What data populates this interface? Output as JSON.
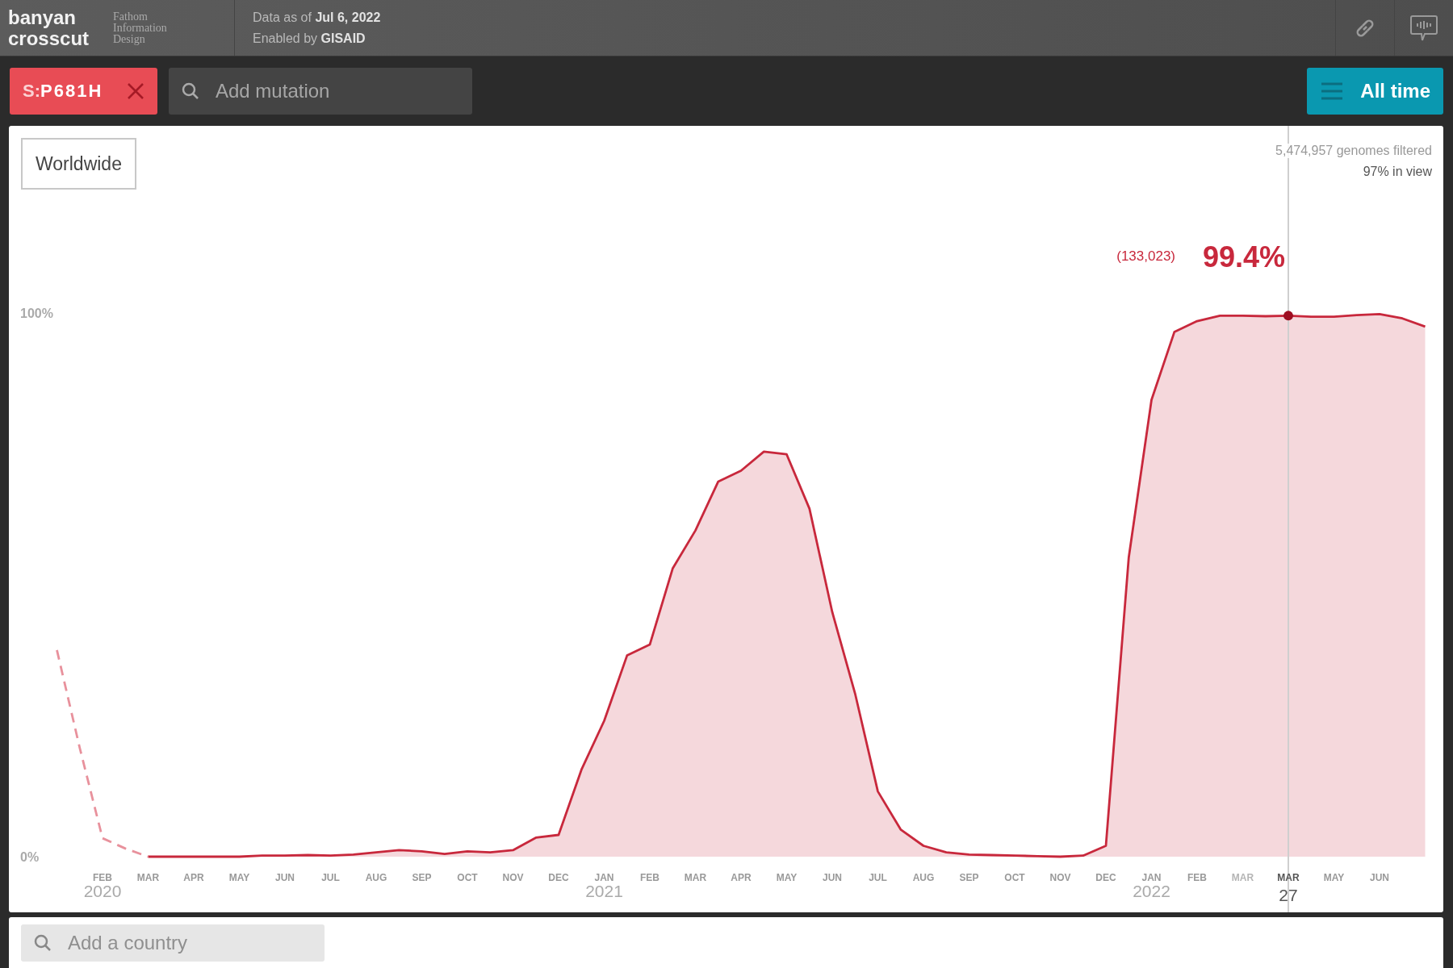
{
  "header": {
    "logo_lines": [
      "banyan",
      "crosscut"
    ],
    "credit_lines": [
      "Fathom",
      "Information",
      "Design"
    ],
    "data_date": "Data as of **Jul 6, 2022**",
    "enabled_by": "Enabled by **GISAID**"
  },
  "toolbar": {
    "mutations": [
      {
        "gene": "S:",
        "name": "P681H"
      }
    ],
    "search": {
      "placeholder": "Add mutation"
    },
    "range_button": "All time"
  },
  "chart_panel": {
    "region_button": "Worldwide",
    "genomes_filtered": "5,474,957 genomes filtered",
    "in_view": "97% in view",
    "hover_date": {
      "month": "MAR",
      "day": "27"
    },
    "chart_data": {
      "type": "area",
      "ylim": [
        0,
        1
      ],
      "yticks": [
        {
          "value": 0,
          "label": "0%"
        },
        {
          "value": 1,
          "label": "100%"
        }
      ],
      "categories": [
        null,
        null,
        "FEB",
        null,
        "MAR",
        null,
        "APR",
        null,
        "MAY",
        null,
        "JUN",
        null,
        "JUL",
        null,
        "AUG",
        null,
        "SEP",
        null,
        "OCT",
        null,
        "NOV",
        null,
        "DEC",
        null,
        "JAN",
        null,
        "FEB",
        null,
        "MAR",
        null,
        "APR",
        null,
        "MAY",
        null,
        "JUN",
        null,
        "JUL",
        null,
        "AUG",
        null,
        "SEP",
        null,
        "OCT",
        null,
        "NOV",
        null,
        "DEC",
        null,
        "JAN",
        null,
        "FEB",
        null,
        "MAR",
        null,
        null,
        null,
        "MAY",
        null,
        "JUN",
        null,
        null
      ],
      "series": [
        {
          "color": "#c8283c",
          "values": [
            null,
            null,
            null,
            null,
            0,
            0,
            0,
            0,
            0,
            0.002,
            0.002,
            0.003,
            0.002,
            0.004,
            0.008,
            0.012,
            0.01,
            0.005,
            0.01,
            0.008,
            0.012,
            0.035,
            0.04,
            0.16,
            0.25,
            0.37,
            0.39,
            0.53,
            0.6,
            0.69,
            0.71,
            0.745,
            0.74,
            0.64,
            0.45,
            0.3,
            0.12,
            0.05,
            0.02,
            0.008,
            0.004,
            0.003,
            0.002,
            0.001,
            0,
            0.002,
            0.02,
            0.55,
            0.84,
            0.965,
            0.985,
            0.995,
            0.995,
            0.994,
            0.995,
            0.993,
            0.993,
            0.996,
            0.998,
            0.99,
            0.975
          ]
        },
        {
          "type": "line",
          "line_style": "dashed",
          "color": "#e8919c",
          "values": [
            0.38,
            0.2,
            0.034,
            0.015,
            0,
            null,
            null,
            null,
            null,
            null,
            null,
            null,
            null,
            null,
            null,
            null,
            null,
            null,
            null,
            null,
            null,
            null,
            null,
            null,
            null,
            null,
            null,
            null,
            null,
            null,
            null,
            null,
            null,
            null,
            null,
            null,
            null,
            null,
            null,
            null,
            null,
            null,
            null,
            null,
            null,
            null,
            null,
            null,
            null,
            null,
            null,
            null,
            null,
            null,
            null,
            null,
            null,
            null,
            null,
            null,
            null
          ]
        }
      ],
      "annotations": [
        "2020",
        "2021",
        "2022",
        "(133,023)",
        "99.4%"
      ]
    }
  },
  "country_panel": {
    "search": {
      "placeholder": "Add a country"
    }
  }
}
